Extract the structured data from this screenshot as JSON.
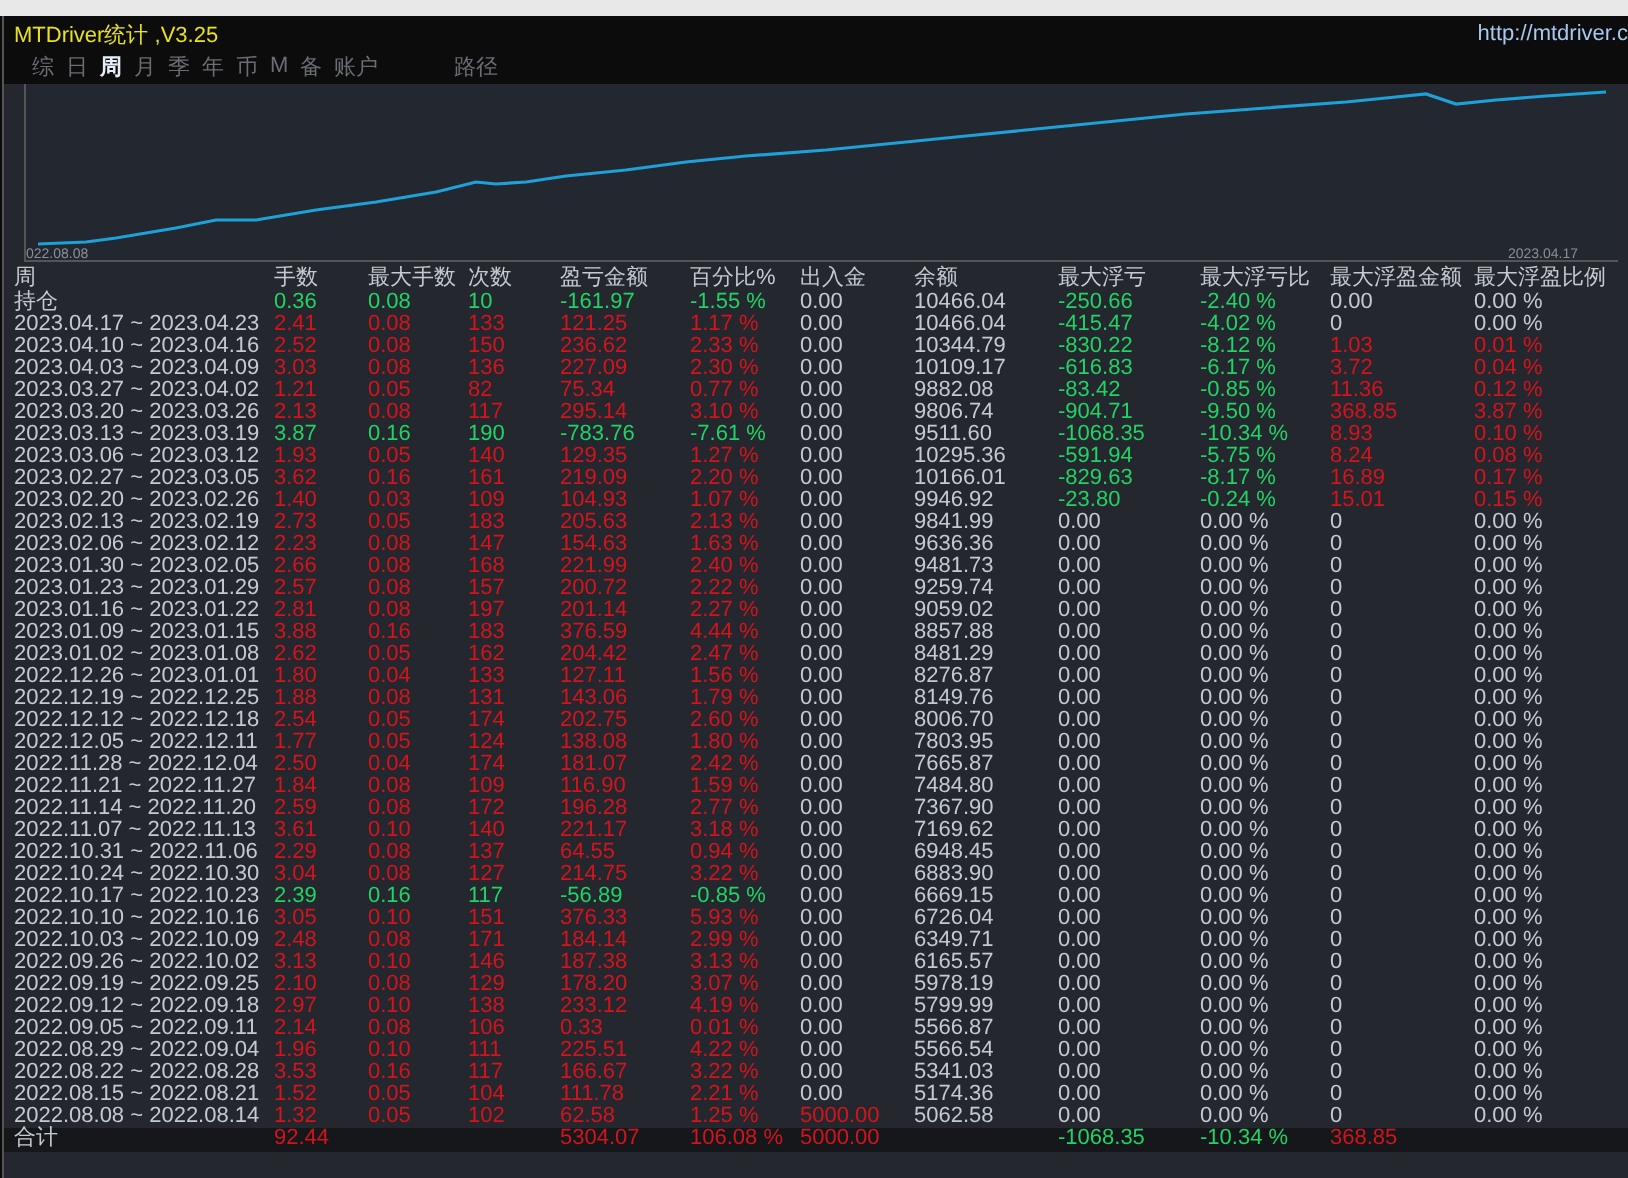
{
  "window": {
    "title": "MTDriver统计 ,V3.25",
    "url": "http://mtdriver.c"
  },
  "tabs": [
    {
      "label": "综",
      "selected": false
    },
    {
      "label": "日",
      "selected": false
    },
    {
      "label": "周",
      "selected": true
    },
    {
      "label": "月",
      "selected": false
    },
    {
      "label": "季",
      "selected": false
    },
    {
      "label": "年",
      "selected": false
    },
    {
      "label": "币",
      "selected": false
    },
    {
      "label": "M",
      "selected": false
    },
    {
      "label": "备",
      "selected": false
    },
    {
      "label": "账户",
      "selected": false
    },
    {
      "label": "路径",
      "selected": false
    }
  ],
  "chart": {
    "start_label": "022.08.08",
    "end_label": "2023.04.17"
  },
  "table": {
    "columns": [
      "周",
      "手数",
      "最大手数",
      "次数",
      "盈亏金额",
      "百分比%",
      "出入金",
      "余额",
      "最大浮亏",
      "最大浮亏比",
      "最大浮盈金额",
      "最大浮盈比例"
    ],
    "rows": [
      {
        "cells": [
          "持仓",
          "0.36",
          "0.08",
          "10",
          "-161.97",
          "-1.55 %",
          "0.00",
          "10466.04",
          "-250.66",
          "-2.40 %",
          "0.00",
          "0.00 %"
        ],
        "loss": true,
        "drawdown": true,
        "peak": false,
        "deposit": false
      },
      {
        "cells": [
          "2023.04.17 ~ 2023.04.23",
          "2.41",
          "0.08",
          "133",
          "121.25",
          "1.17 %",
          "0.00",
          "10466.04",
          "-415.47",
          "-4.02 %",
          "0",
          "0.00 %"
        ],
        "loss": false,
        "drawdown": true,
        "peak": false,
        "deposit": false
      },
      {
        "cells": [
          "2023.04.10 ~ 2023.04.16",
          "2.52",
          "0.08",
          "150",
          "236.62",
          "2.33 %",
          "0.00",
          "10344.79",
          "-830.22",
          "-8.12 %",
          "1.03",
          "0.01 %"
        ],
        "loss": false,
        "drawdown": true,
        "peak": true,
        "deposit": false
      },
      {
        "cells": [
          "2023.04.03 ~ 2023.04.09",
          "3.03",
          "0.08",
          "136",
          "227.09",
          "2.30 %",
          "0.00",
          "10109.17",
          "-616.83",
          "-6.17 %",
          "3.72",
          "0.04 %"
        ],
        "loss": false,
        "drawdown": true,
        "peak": true,
        "deposit": false
      },
      {
        "cells": [
          "2023.03.27 ~ 2023.04.02",
          "1.21",
          "0.05",
          "82",
          "75.34",
          "0.77 %",
          "0.00",
          "9882.08",
          "-83.42",
          "-0.85 %",
          "11.36",
          "0.12 %"
        ],
        "loss": false,
        "drawdown": true,
        "peak": true,
        "deposit": false
      },
      {
        "cells": [
          "2023.03.20 ~ 2023.03.26",
          "2.13",
          "0.08",
          "117",
          "295.14",
          "3.10 %",
          "0.00",
          "9806.74",
          "-904.71",
          "-9.50 %",
          "368.85",
          "3.87 %"
        ],
        "loss": false,
        "drawdown": true,
        "peak": true,
        "deposit": false
      },
      {
        "cells": [
          "2023.03.13 ~ 2023.03.19",
          "3.87",
          "0.16",
          "190",
          "-783.76",
          "-7.61 %",
          "0.00",
          "9511.60",
          "-1068.35",
          "-10.34 %",
          "8.93",
          "0.10 %"
        ],
        "loss": true,
        "drawdown": true,
        "peak": true,
        "deposit": false
      },
      {
        "cells": [
          "2023.03.06 ~ 2023.03.12",
          "1.93",
          "0.05",
          "140",
          "129.35",
          "1.27 %",
          "0.00",
          "10295.36",
          "-591.94",
          "-5.75 %",
          "8.24",
          "0.08 %"
        ],
        "loss": false,
        "drawdown": true,
        "peak": true,
        "deposit": false
      },
      {
        "cells": [
          "2023.02.27 ~ 2023.03.05",
          "3.62",
          "0.16",
          "161",
          "219.09",
          "2.20 %",
          "0.00",
          "10166.01",
          "-829.63",
          "-8.17 %",
          "16.89",
          "0.17 %"
        ],
        "loss": false,
        "drawdown": true,
        "peak": true,
        "deposit": false
      },
      {
        "cells": [
          "2023.02.20 ~ 2023.02.26",
          "1.40",
          "0.03",
          "109",
          "104.93",
          "1.07 %",
          "0.00",
          "9946.92",
          "-23.80",
          "-0.24 %",
          "15.01",
          "0.15 %"
        ],
        "loss": false,
        "drawdown": true,
        "peak": true,
        "deposit": false
      },
      {
        "cells": [
          "2023.02.13 ~ 2023.02.19",
          "2.73",
          "0.05",
          "183",
          "205.63",
          "2.13 %",
          "0.00",
          "9841.99",
          "0.00",
          "0.00 %",
          "0",
          "0.00 %"
        ],
        "loss": false,
        "drawdown": false,
        "peak": false,
        "deposit": false
      },
      {
        "cells": [
          "2023.02.06 ~ 2023.02.12",
          "2.23",
          "0.08",
          "147",
          "154.63",
          "1.63 %",
          "0.00",
          "9636.36",
          "0.00",
          "0.00 %",
          "0",
          "0.00 %"
        ],
        "loss": false,
        "drawdown": false,
        "peak": false,
        "deposit": false
      },
      {
        "cells": [
          "2023.01.30 ~ 2023.02.05",
          "2.66",
          "0.08",
          "168",
          "221.99",
          "2.40 %",
          "0.00",
          "9481.73",
          "0.00",
          "0.00 %",
          "0",
          "0.00 %"
        ],
        "loss": false,
        "drawdown": false,
        "peak": false,
        "deposit": false
      },
      {
        "cells": [
          "2023.01.23 ~ 2023.01.29",
          "2.57",
          "0.08",
          "157",
          "200.72",
          "2.22 %",
          "0.00",
          "9259.74",
          "0.00",
          "0.00 %",
          "0",
          "0.00 %"
        ],
        "loss": false,
        "drawdown": false,
        "peak": false,
        "deposit": false
      },
      {
        "cells": [
          "2023.01.16 ~ 2023.01.22",
          "2.81",
          "0.08",
          "197",
          "201.14",
          "2.27 %",
          "0.00",
          "9059.02",
          "0.00",
          "0.00 %",
          "0",
          "0.00 %"
        ],
        "loss": false,
        "drawdown": false,
        "peak": false,
        "deposit": false
      },
      {
        "cells": [
          "2023.01.09 ~ 2023.01.15",
          "3.88",
          "0.16",
          "183",
          "376.59",
          "4.44 %",
          "0.00",
          "8857.88",
          "0.00",
          "0.00 %",
          "0",
          "0.00 %"
        ],
        "loss": false,
        "drawdown": false,
        "peak": false,
        "deposit": false
      },
      {
        "cells": [
          "2023.01.02 ~ 2023.01.08",
          "2.62",
          "0.05",
          "162",
          "204.42",
          "2.47 %",
          "0.00",
          "8481.29",
          "0.00",
          "0.00 %",
          "0",
          "0.00 %"
        ],
        "loss": false,
        "drawdown": false,
        "peak": false,
        "deposit": false
      },
      {
        "cells": [
          "2022.12.26 ~ 2023.01.01",
          "1.80",
          "0.04",
          "133",
          "127.11",
          "1.56 %",
          "0.00",
          "8276.87",
          "0.00",
          "0.00 %",
          "0",
          "0.00 %"
        ],
        "loss": false,
        "drawdown": false,
        "peak": false,
        "deposit": false
      },
      {
        "cells": [
          "2022.12.19 ~ 2022.12.25",
          "1.88",
          "0.08",
          "131",
          "143.06",
          "1.79 %",
          "0.00",
          "8149.76",
          "0.00",
          "0.00 %",
          "0",
          "0.00 %"
        ],
        "loss": false,
        "drawdown": false,
        "peak": false,
        "deposit": false
      },
      {
        "cells": [
          "2022.12.12 ~ 2022.12.18",
          "2.54",
          "0.05",
          "174",
          "202.75",
          "2.60 %",
          "0.00",
          "8006.70",
          "0.00",
          "0.00 %",
          "0",
          "0.00 %"
        ],
        "loss": false,
        "drawdown": false,
        "peak": false,
        "deposit": false
      },
      {
        "cells": [
          "2022.12.05 ~ 2022.12.11",
          "1.77",
          "0.05",
          "124",
          "138.08",
          "1.80 %",
          "0.00",
          "7803.95",
          "0.00",
          "0.00 %",
          "0",
          "0.00 %"
        ],
        "loss": false,
        "drawdown": false,
        "peak": false,
        "deposit": false
      },
      {
        "cells": [
          "2022.11.28 ~ 2022.12.04",
          "2.50",
          "0.04",
          "174",
          "181.07",
          "2.42 %",
          "0.00",
          "7665.87",
          "0.00",
          "0.00 %",
          "0",
          "0.00 %"
        ],
        "loss": false,
        "drawdown": false,
        "peak": false,
        "deposit": false
      },
      {
        "cells": [
          "2022.11.21 ~ 2022.11.27",
          "1.84",
          "0.08",
          "109",
          "116.90",
          "1.59 %",
          "0.00",
          "7484.80",
          "0.00",
          "0.00 %",
          "0",
          "0.00 %"
        ],
        "loss": false,
        "drawdown": false,
        "peak": false,
        "deposit": false
      },
      {
        "cells": [
          "2022.11.14 ~ 2022.11.20",
          "2.59",
          "0.08",
          "172",
          "196.28",
          "2.77 %",
          "0.00",
          "7367.90",
          "0.00",
          "0.00 %",
          "0",
          "0.00 %"
        ],
        "loss": false,
        "drawdown": false,
        "peak": false,
        "deposit": false
      },
      {
        "cells": [
          "2022.11.07 ~ 2022.11.13",
          "3.61",
          "0.10",
          "140",
          "221.17",
          "3.18 %",
          "0.00",
          "7169.62",
          "0.00",
          "0.00 %",
          "0",
          "0.00 %"
        ],
        "loss": false,
        "drawdown": false,
        "peak": false,
        "deposit": false
      },
      {
        "cells": [
          "2022.10.31 ~ 2022.11.06",
          "2.29",
          "0.08",
          "137",
          "64.55",
          "0.94 %",
          "0.00",
          "6948.45",
          "0.00",
          "0.00 %",
          "0",
          "0.00 %"
        ],
        "loss": false,
        "drawdown": false,
        "peak": false,
        "deposit": false
      },
      {
        "cells": [
          "2022.10.24 ~ 2022.10.30",
          "3.04",
          "0.08",
          "127",
          "214.75",
          "3.22 %",
          "0.00",
          "6883.90",
          "0.00",
          "0.00 %",
          "0",
          "0.00 %"
        ],
        "loss": false,
        "drawdown": false,
        "peak": false,
        "deposit": false
      },
      {
        "cells": [
          "2022.10.17 ~ 2022.10.23",
          "2.39",
          "0.16",
          "117",
          "-56.89",
          "-0.85 %",
          "0.00",
          "6669.15",
          "0.00",
          "0.00 %",
          "0",
          "0.00 %"
        ],
        "loss": true,
        "drawdown": false,
        "peak": false,
        "deposit": false
      },
      {
        "cells": [
          "2022.10.10 ~ 2022.10.16",
          "3.05",
          "0.10",
          "151",
          "376.33",
          "5.93 %",
          "0.00",
          "6726.04",
          "0.00",
          "0.00 %",
          "0",
          "0.00 %"
        ],
        "loss": false,
        "drawdown": false,
        "peak": false,
        "deposit": false
      },
      {
        "cells": [
          "2022.10.03 ~ 2022.10.09",
          "2.48",
          "0.08",
          "171",
          "184.14",
          "2.99 %",
          "0.00",
          "6349.71",
          "0.00",
          "0.00 %",
          "0",
          "0.00 %"
        ],
        "loss": false,
        "drawdown": false,
        "peak": false,
        "deposit": false
      },
      {
        "cells": [
          "2022.09.26 ~ 2022.10.02",
          "3.13",
          "0.10",
          "146",
          "187.38",
          "3.13 %",
          "0.00",
          "6165.57",
          "0.00",
          "0.00 %",
          "0",
          "0.00 %"
        ],
        "loss": false,
        "drawdown": false,
        "peak": false,
        "deposit": false
      },
      {
        "cells": [
          "2022.09.19 ~ 2022.09.25",
          "2.10",
          "0.08",
          "129",
          "178.20",
          "3.07 %",
          "0.00",
          "5978.19",
          "0.00",
          "0.00 %",
          "0",
          "0.00 %"
        ],
        "loss": false,
        "drawdown": false,
        "peak": false,
        "deposit": false
      },
      {
        "cells": [
          "2022.09.12 ~ 2022.09.18",
          "2.97",
          "0.10",
          "138",
          "233.12",
          "4.19 %",
          "0.00",
          "5799.99",
          "0.00",
          "0.00 %",
          "0",
          "0.00 %"
        ],
        "loss": false,
        "drawdown": false,
        "peak": false,
        "deposit": false
      },
      {
        "cells": [
          "2022.09.05 ~ 2022.09.11",
          "2.14",
          "0.08",
          "106",
          "0.33",
          "0.01 %",
          "0.00",
          "5566.87",
          "0.00",
          "0.00 %",
          "0",
          "0.00 %"
        ],
        "loss": false,
        "drawdown": false,
        "peak": false,
        "deposit": false
      },
      {
        "cells": [
          "2022.08.29 ~ 2022.09.04",
          "1.96",
          "0.10",
          "111",
          "225.51",
          "4.22 %",
          "0.00",
          "5566.54",
          "0.00",
          "0.00 %",
          "0",
          "0.00 %"
        ],
        "loss": false,
        "drawdown": false,
        "peak": false,
        "deposit": false
      },
      {
        "cells": [
          "2022.08.22 ~ 2022.08.28",
          "3.53",
          "0.16",
          "117",
          "166.67",
          "3.22 %",
          "0.00",
          "5341.03",
          "0.00",
          "0.00 %",
          "0",
          "0.00 %"
        ],
        "loss": false,
        "drawdown": false,
        "peak": false,
        "deposit": false
      },
      {
        "cells": [
          "2022.08.15 ~ 2022.08.21",
          "1.52",
          "0.05",
          "104",
          "111.78",
          "2.21 %",
          "0.00",
          "5174.36",
          "0.00",
          "0.00 %",
          "0",
          "0.00 %"
        ],
        "loss": false,
        "drawdown": false,
        "peak": false,
        "deposit": false
      },
      {
        "cells": [
          "2022.08.08 ~ 2022.08.14",
          "1.32",
          "0.05",
          "102",
          "62.58",
          "1.25 %",
          "5000.00",
          "5062.58",
          "0.00",
          "0.00 %",
          "0",
          "0.00 %"
        ],
        "loss": false,
        "drawdown": false,
        "peak": false,
        "deposit": true
      }
    ],
    "total": {
      "cells": [
        "合计",
        "92.44",
        "",
        "",
        "5304.07",
        "106.08 %",
        "5000.00",
        "",
        "-1068.35",
        "-10.34 %",
        "368.85",
        ""
      ],
      "loss": false,
      "drawdown": true,
      "peak": true,
      "deposit": true
    }
  }
}
